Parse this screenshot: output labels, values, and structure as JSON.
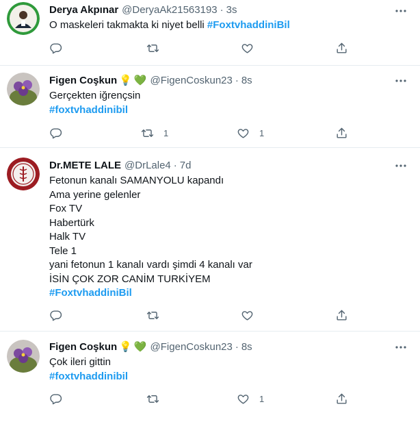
{
  "tweets": [
    {
      "name": "Derya Akpınar",
      "emojis": [],
      "handle": "@DeryaAk21563193",
      "separator": "·",
      "time": "3s",
      "lines": [
        {
          "text": "O maskeleri takmakta ki niyet belli ",
          "hashtag": "#FoxtvhaddiniBil"
        }
      ],
      "actions": {
        "reply_count": "",
        "retweet_count": "",
        "like_count": ""
      }
    },
    {
      "name": "Figen Coşkun",
      "emojis": [
        "💡",
        "💚"
      ],
      "handle": "@FigenCoskun23",
      "separator": "·",
      "time": "8s",
      "lines": [
        {
          "text": "Gerçekten iğrençsin",
          "hashtag": ""
        },
        {
          "text": "",
          "hashtag": "#foxtvhaddinibil"
        }
      ],
      "actions": {
        "reply_count": "",
        "retweet_count": "1",
        "like_count": "1"
      }
    },
    {
      "name": "Dr.METE LALE",
      "emojis": [],
      "handle": "@DrLale4",
      "separator": "·",
      "time": "7d",
      "lines": [
        {
          "text": "Fetonun kanalı SAMANYOLU kapandı",
          "hashtag": ""
        },
        {
          "text": "Ama yerine gelenler",
          "hashtag": ""
        },
        {
          "text": "Fox TV",
          "hashtag": ""
        },
        {
          "text": "Habertürk",
          "hashtag": ""
        },
        {
          "text": "Halk TV",
          "hashtag": ""
        },
        {
          "text": "Tele 1",
          "hashtag": ""
        },
        {
          "text": "yani fetonun 1 kanalı vardı şimdi 4 kanalı var",
          "hashtag": ""
        },
        {
          "text": "İSİN ÇOK ZOR CANİM TURKİYEM",
          "hashtag": ""
        },
        {
          "text": "",
          "hashtag": "#FoxtvhaddiniBil"
        }
      ],
      "actions": {
        "reply_count": "",
        "retweet_count": "",
        "like_count": ""
      }
    },
    {
      "name": "Figen Coşkun",
      "emojis": [
        "💡",
        "💚"
      ],
      "handle": "@FigenCoskun23",
      "separator": "·",
      "time": "8s",
      "lines": [
        {
          "text": "Çok ileri gittin",
          "hashtag": ""
        },
        {
          "text": "",
          "hashtag": "#foxtvhaddinibil"
        }
      ],
      "actions": {
        "reply_count": "",
        "retweet_count": "",
        "like_count": "1"
      }
    }
  ],
  "icons": {
    "reply": "reply-icon",
    "retweet": "retweet-icon",
    "like": "like-icon",
    "share": "share-icon",
    "more": "more-icon"
  },
  "colors": {
    "hashtag": "#1d9bf0",
    "secondary_text": "#536471",
    "divider": "#e6ecf0"
  }
}
